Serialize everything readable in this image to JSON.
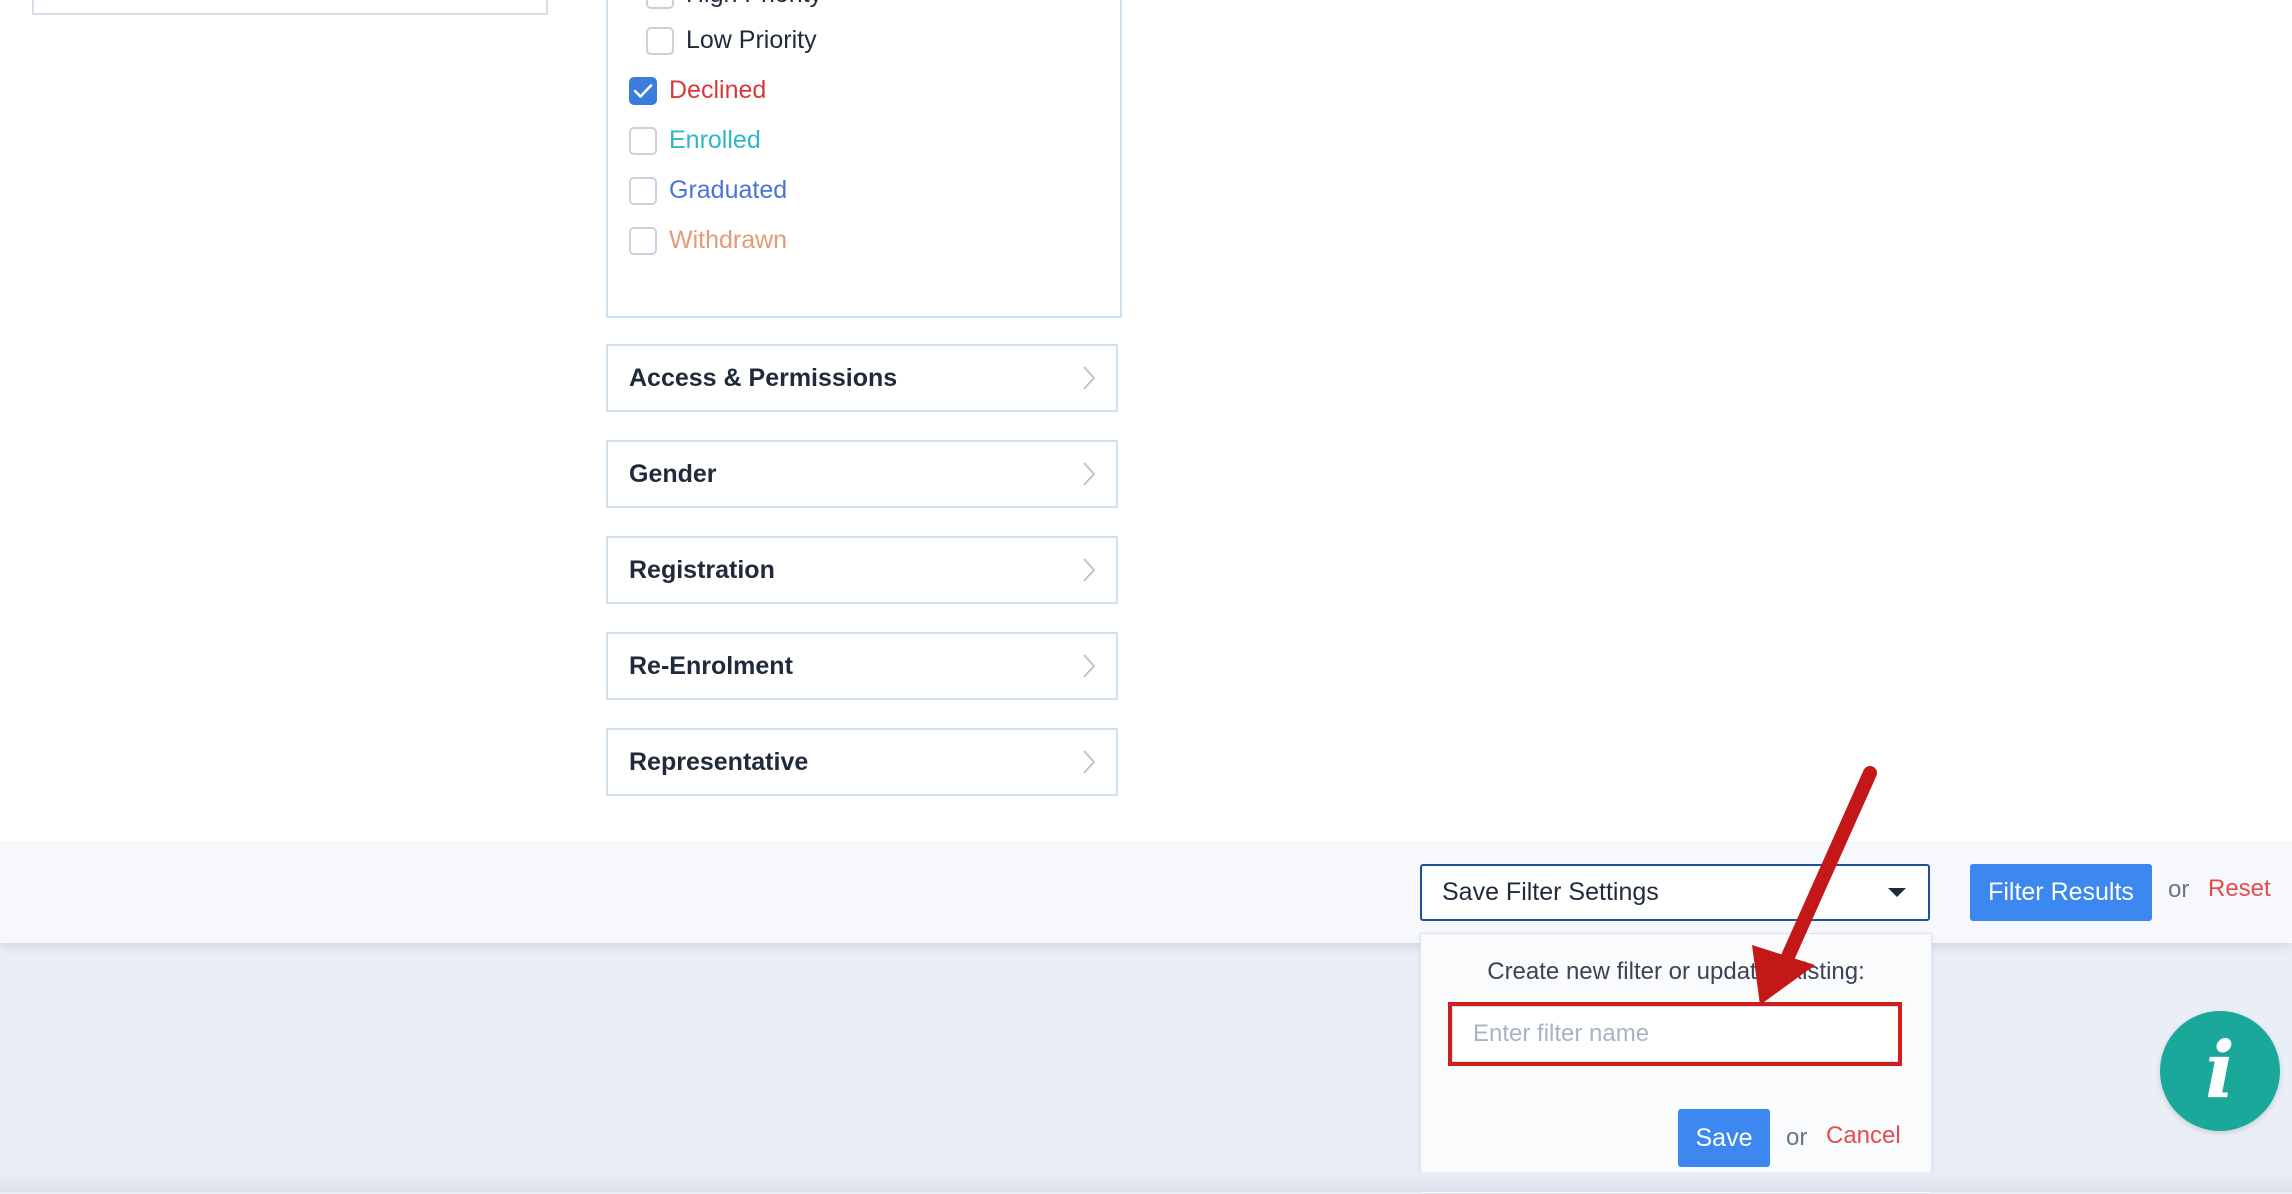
{
  "status_filters": {
    "items": [
      {
        "label": "High Priority",
        "checked": false,
        "color": "#1f2a3a"
      },
      {
        "label": "Low Priority",
        "checked": false,
        "color": "#1f2a3a"
      },
      {
        "label": "Declined",
        "checked": true,
        "color": "#d83a3a"
      },
      {
        "label": "Enrolled",
        "checked": false,
        "color": "#2fb7c9"
      },
      {
        "label": "Graduated",
        "checked": false,
        "color": "#4a74d8"
      },
      {
        "label": "Withdrawn",
        "checked": false,
        "color": "#e49a78"
      }
    ]
  },
  "accordion": {
    "sections": [
      {
        "label": "Access & Permissions"
      },
      {
        "label": "Gender"
      },
      {
        "label": "Registration"
      },
      {
        "label": "Re-Enrolment"
      },
      {
        "label": "Representative"
      }
    ]
  },
  "footer": {
    "save_filter_select": "Save Filter Settings",
    "filter_results_button": "Filter Results",
    "or_text": "or",
    "reset_link": "Reset"
  },
  "save_filter_popover": {
    "title": "Create new filter or update existing:",
    "input_placeholder": "Enter filter name",
    "input_value": "",
    "save_button": "Save",
    "or_text": "or",
    "cancel_link": "Cancel"
  },
  "info_button": {
    "glyph": "i"
  },
  "colors": {
    "primary_button": "#3d87f0",
    "link_red": "#e54b4b",
    "annotation_red": "#cc1f1f",
    "info_teal": "#1aa89b"
  }
}
